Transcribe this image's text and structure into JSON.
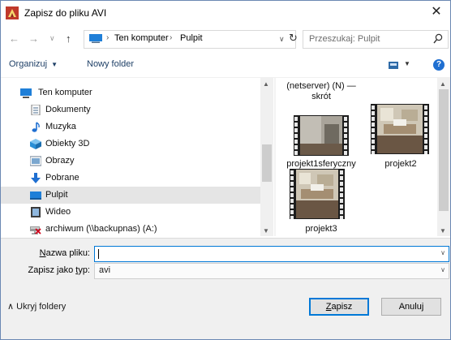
{
  "window": {
    "title": "Zapisz do pliku AVI",
    "close_glyph": "✕"
  },
  "address": {
    "back_glyph": "←",
    "forward_glyph": "→",
    "recent_glyph": "∨",
    "up_glyph": "↑",
    "crumbs": [
      "Ten komputer",
      "Pulpit"
    ],
    "crumb_sep": "›",
    "dropdown_glyph": "∨",
    "refresh_glyph": "↻",
    "search_placeholder": "Przeszukaj: Pulpit"
  },
  "toolbar": {
    "organize_label": "Organizuj",
    "organize_caret": "▼",
    "new_folder_label": "Nowy folder",
    "view_caret": "▼",
    "help_glyph": "?"
  },
  "nav_pane": {
    "items": [
      {
        "label": "Ten komputer",
        "icon": "computer-icon"
      },
      {
        "label": "Dokumenty",
        "icon": "documents-icon"
      },
      {
        "label": "Muzyka",
        "icon": "music-icon"
      },
      {
        "label": "Obiekty 3D",
        "icon": "objects-3d-icon"
      },
      {
        "label": "Obrazy",
        "icon": "pictures-icon"
      },
      {
        "label": "Pobrane",
        "icon": "downloads-icon"
      },
      {
        "label": "Pulpit",
        "icon": "desktop-icon",
        "selected": true
      },
      {
        "label": "Wideo",
        "icon": "video-icon"
      },
      {
        "label": "archiwum (\\\\backupnas) (A:)",
        "icon": "network-drive-icon"
      }
    ],
    "scroll_up": "▲",
    "scroll_down": "▼"
  },
  "file_pane": {
    "partial_item": {
      "line1": "(netserver) (N) —",
      "line2": "skrót"
    },
    "files": [
      {
        "label": "projekt1sferyczny"
      },
      {
        "label": "projekt2"
      },
      {
        "label": "projekt3"
      }
    ],
    "scroll_up": "▲",
    "scroll_down": "▼"
  },
  "form": {
    "filename_label_u": "N",
    "filename_label_rest": "azwa pliku:",
    "filename_value": "",
    "type_label_pre": "Zapisz jako ",
    "type_label_u": "t",
    "type_label_rest": "yp:",
    "type_value": "avi",
    "dropdown_glyph": "∨"
  },
  "buttons": {
    "hide_folders_glyph": "∧",
    "hide_folders_label": "Ukryj foldery",
    "save_label_u": "Z",
    "save_label_rest": "apisz",
    "cancel_label": "Anuluj"
  }
}
